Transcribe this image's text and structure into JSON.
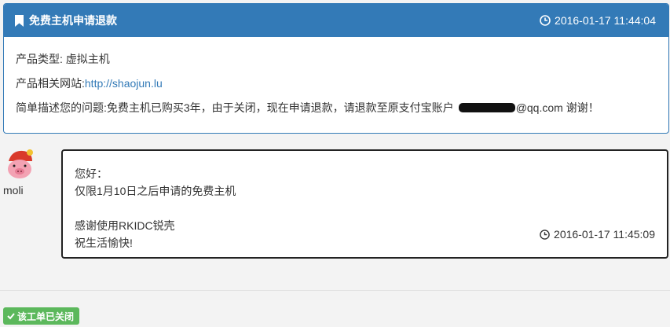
{
  "ticket": {
    "title": "免费主机申请退款",
    "timestamp": "2016-01-17 11:44:04",
    "product_type_label": "产品类型: ",
    "product_type_value": "虚拟主机",
    "site_label": "产品相关网站:",
    "site_url": "http://shaojun.lu",
    "description_label": "简单描述您的问题:",
    "description_text": "免费主机已购买3年，由于关闭，现在申请退款，请退款至原支付宝账户",
    "email_suffix": "@qq.com 谢谢！"
  },
  "reply": {
    "username": "moli",
    "lines": [
      "您好：",
      "仅限1月10日之后申请的免费主机",
      "",
      "感谢使用RKIDC锐壳",
      "祝生活愉快!"
    ],
    "timestamp": "2016-01-17 11:45:09"
  },
  "status": {
    "closed_label": "该工单已关闭"
  },
  "colors": {
    "primary": "#337ab7",
    "success": "#5cb85c",
    "link": "#337ab7"
  },
  "icons": [
    "bookmark-icon",
    "clock-icon",
    "check-icon"
  ]
}
